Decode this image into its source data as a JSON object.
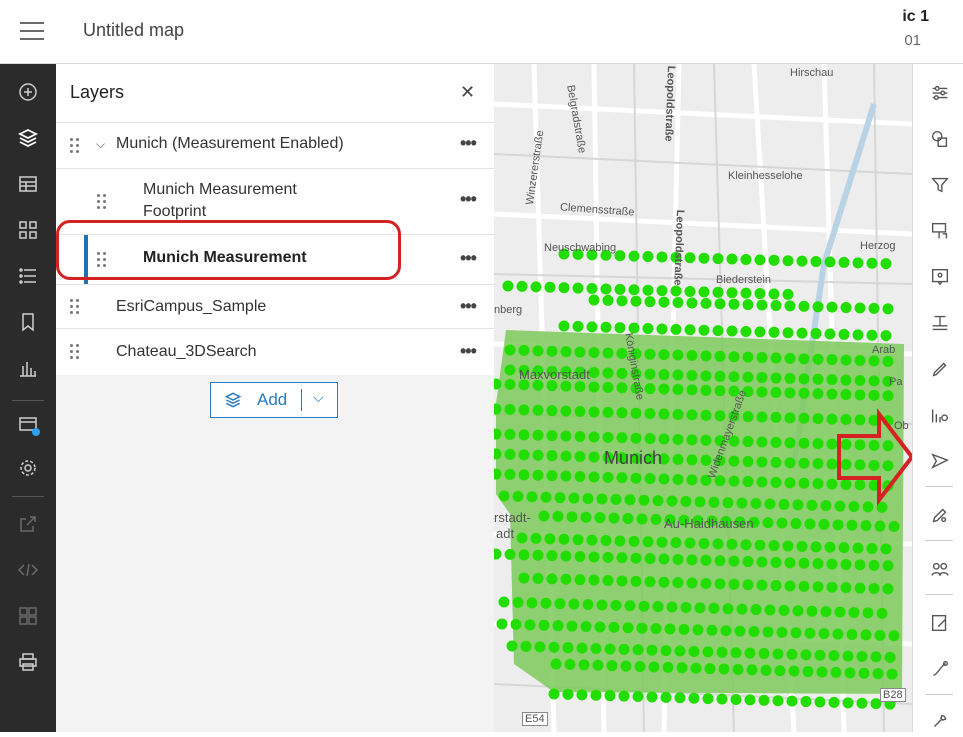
{
  "header": {
    "title": "Untitled map",
    "account_name": "ic 1",
    "account_sub": "01"
  },
  "left_toolbar": [
    "add-icon",
    "layers-icon",
    "table-icon",
    "legend-icon",
    "list-icon",
    "bookmark-icon",
    "charts-icon",
    "basemap-icon",
    "settings-icon",
    "share-icon",
    "embed-icon",
    "apps-icon",
    "print-icon"
  ],
  "panel": {
    "title": "Layers",
    "group": {
      "label": "Munich (Measurement Enabled)"
    },
    "sublayers": [
      {
        "label": "Munich Measurement Footprint"
      },
      {
        "label": "Munich Measurement",
        "selected": true
      }
    ],
    "layers": [
      {
        "label": "EsriCampus_Sample"
      },
      {
        "label": "Chateau_3DSearch"
      }
    ],
    "add_label": "Add"
  },
  "map": {
    "city": "Munich",
    "labels": {
      "hirschau": "Hirschau",
      "belgradstrasse": "Belgradstraße",
      "leopoldstrasse_top": "Leopoldstraße",
      "kleinhesselohe": "Kleinhesselohe",
      "clemensstrasse": "Clemensstraße",
      "leopoldstrasse": "Leopoldstraße",
      "winzererstrasse": "Winzererstraße",
      "neuschwabing": "Neuschwabing",
      "biederstein": "Biederstein",
      "herzog": "Herzog",
      "nberg": "nberg",
      "maxvorstadt": "Maxvorstadt",
      "arab": "Arab",
      "pa": "Pa",
      "au_haidhausen": "Au-Haidhausen",
      "stadt": "rstadt-",
      "stadt2": "adt",
      "widenmayerstrasse": "Widenmayerstraße",
      "b28": "B28",
      "e54": "E54",
      "koenigin": "Königinstraße",
      "ob": "Ob"
    },
    "colors": {
      "coverage": "#7cc95c",
      "points": "#22dd00",
      "arrow": "#d42222"
    }
  },
  "right_toolbar": [
    "properties-icon",
    "styles-icon",
    "filter-icon",
    "effects-icon",
    "pop-ups-icon",
    "labels-icon",
    "edit-icon",
    "measure-icon",
    "directions-icon",
    "sketch-icon",
    "analysis-icon",
    "notes-icon",
    "draw-icon",
    "tools-icon"
  ]
}
